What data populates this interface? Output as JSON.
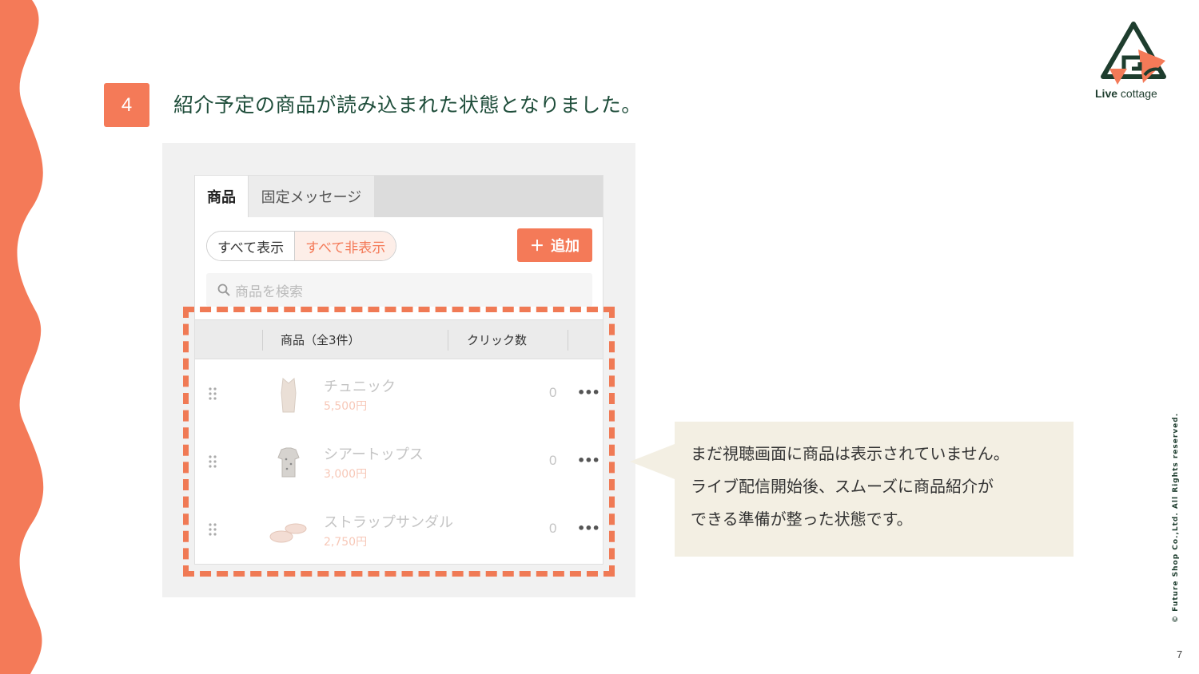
{
  "step": {
    "number": "4",
    "color": "#f47a58"
  },
  "heading": "紹介予定の商品が読み込まれた状態となりました。",
  "brand": {
    "name_bold": "Live",
    "name_rest": " cottage",
    "color": "#1e3d2e",
    "accent": "#f47a58"
  },
  "copyright": "© Future Shop Co.,Ltd. All Rights reserved.",
  "page_number": "7",
  "app": {
    "tabs": [
      {
        "label": "商品",
        "active": true
      },
      {
        "label": "固定メッセージ",
        "active": false
      }
    ],
    "toggle": {
      "show_all": "すべて表示",
      "hide_all": "すべて非表示",
      "selected": "hide_all"
    },
    "add_button": {
      "icon": "plus-icon",
      "label": "追加"
    },
    "search": {
      "icon": "search-icon",
      "placeholder": "商品を検索"
    },
    "table": {
      "headers": {
        "name": "商品（全3件）",
        "clicks": "クリック数"
      },
      "rows": [
        {
          "name": "チュニック",
          "price": "5,500円",
          "clicks": "0",
          "thumb": "tunic-image"
        },
        {
          "name": "シアートップス",
          "price": "3,000円",
          "clicks": "0",
          "thumb": "sheer-top-image"
        },
        {
          "name": "ストラップサンダル",
          "price": "2,750円",
          "clicks": "0",
          "thumb": "strap-sandal-image"
        }
      ],
      "menu_glyph": "•••"
    }
  },
  "callout": {
    "lines": [
      "まだ視聴画面に商品は表示されていません。",
      "ライブ配信開始後、スムーズに商品紹介が",
      "できる準備が整った状態です。"
    ]
  }
}
